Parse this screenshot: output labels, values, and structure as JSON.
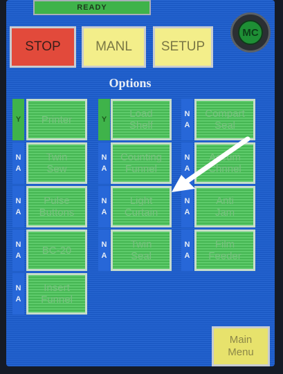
{
  "status_bar": {
    "text": "READY"
  },
  "top_buttons": {
    "stop": "STOP",
    "manual": "MANL",
    "setup": "SETUP"
  },
  "mc_indicator": {
    "label": "MC"
  },
  "options": {
    "title": "Options",
    "na_label_n": "N",
    "na_label_a": "A",
    "items": [
      {
        "label_lines": [
          "Printer"
        ],
        "status": "Y"
      },
      {
        "label_lines": [
          "Load",
          "Shelf"
        ],
        "status": "Y"
      },
      {
        "label_lines": [
          "Compart",
          "Seal"
        ],
        "status": "NA"
      },
      {
        "label_lines": [
          "Twin",
          "Sew"
        ],
        "status": "NA"
      },
      {
        "label_lines": [
          "Counting",
          "Funnel"
        ],
        "status": "NA"
      },
      {
        "label_lines": [
          "Accum",
          "Chnnel"
        ],
        "status": "NA"
      },
      {
        "label_lines": [
          "Pulse",
          "Buttons"
        ],
        "status": "NA"
      },
      {
        "label_lines": [
          "Light",
          "Curtain"
        ],
        "status": "NA"
      },
      {
        "label_lines": [
          "Anti",
          "Jam"
        ],
        "status": "NA"
      },
      {
        "label_lines": [
          "BC-20"
        ],
        "status": "NA"
      },
      {
        "label_lines": [
          "Twin",
          "Seal"
        ],
        "status": "NA"
      },
      {
        "label_lines": [
          "Film",
          "Feeder"
        ],
        "status": "NA"
      },
      {
        "label_lines": [
          "Insert",
          "Funnel"
        ],
        "status": "NA"
      }
    ]
  },
  "main_menu": {
    "line1": "Main",
    "line2": "Menu"
  },
  "colors": {
    "screen_bg": "#1d5fd0",
    "option_green": "#4cc55a",
    "stop_red": "#e24a3b",
    "yellow_btn": "#f3ee8a"
  }
}
